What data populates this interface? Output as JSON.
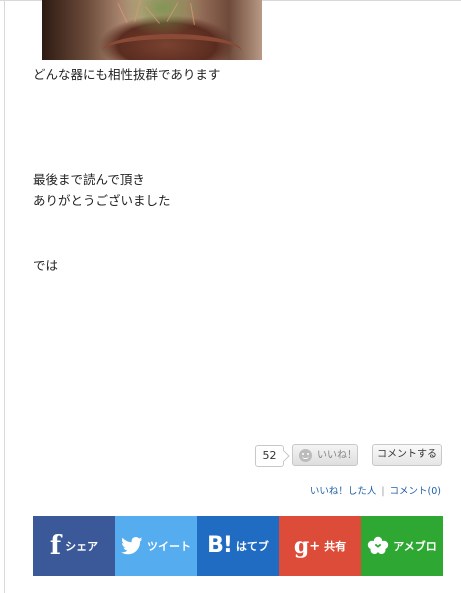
{
  "post": {
    "photo_alt": "cactus-in-pot-photo",
    "line1": "どんな器にも相性抜群であります",
    "line2": "最後まで読んで頂き",
    "line3": "ありがとうございました",
    "line4": "では"
  },
  "like": {
    "count": "52",
    "button_label": "いいね！"
  },
  "comment": {
    "button_label": "コメントする"
  },
  "links": {
    "liked_users": "いいね！した人",
    "separator": "|",
    "comments": "コメント(0)"
  },
  "share": {
    "facebook": {
      "label": "シェア",
      "icon": "facebook-icon",
      "color": "#3b5998"
    },
    "twitter": {
      "label": "ツイート",
      "icon": "twitter-bird-icon",
      "color": "#55acee"
    },
    "hatena": {
      "label": "はてブ",
      "icon": "hatena-bookmark-icon",
      "color": "#1f6cc2"
    },
    "googleplus": {
      "label": "共有",
      "icon": "google-plus-icon",
      "color": "#dd4b39"
    },
    "ameblo": {
      "label": "アメブロ",
      "icon": "ameblo-icon",
      "color": "#2ea833"
    }
  }
}
